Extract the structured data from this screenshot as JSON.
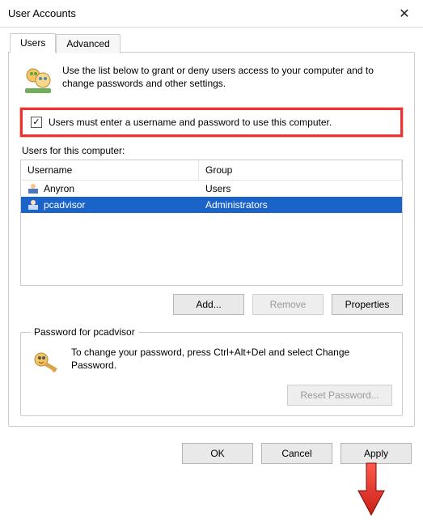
{
  "window": {
    "title": "User Accounts"
  },
  "tabs": {
    "users": "Users",
    "advanced": "Advanced"
  },
  "intro": "Use the list below to grant or deny users access to your computer and to change passwords and other settings.",
  "checkbox": {
    "label": "Users must enter a username and password to use this computer.",
    "checked": true
  },
  "users_section_label": "Users for this computer:",
  "columns": {
    "username": "Username",
    "group": "Group"
  },
  "rows": [
    {
      "username": "Anyron",
      "group": "Users",
      "selected": false
    },
    {
      "username": "pcadvisor",
      "group": "Administrators",
      "selected": true
    }
  ],
  "user_buttons": {
    "add": "Add...",
    "remove": "Remove",
    "properties": "Properties",
    "remove_enabled": false
  },
  "password_group": {
    "legend": "Password for pcadvisor",
    "text": "To change your password, press Ctrl+Alt+Del and select Change Password.",
    "reset": "Reset Password...",
    "reset_enabled": false
  },
  "dialog_buttons": {
    "ok": "OK",
    "cancel": "Cancel",
    "apply": "Apply"
  },
  "colors": {
    "selection": "#1a63c9",
    "highlight_border": "#e33"
  }
}
